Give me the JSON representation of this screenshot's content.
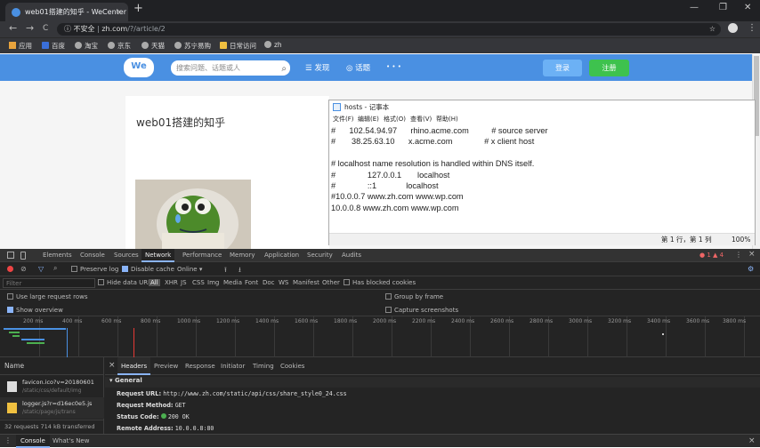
{
  "browser": {
    "tab_title": "web01搭建的知乎 - WeCenter",
    "tab_close": "×",
    "new_tab": "+",
    "window_controls": [
      "—",
      "❐",
      "✕"
    ],
    "nav": [
      "←",
      "→",
      "C"
    ],
    "insecure_label": "不安全",
    "url_host": "zh.com",
    "url_path": "/?/article/2",
    "star": "☆",
    "menu": "⋮",
    "bookmarks": [
      "应用",
      "百度",
      "淘宝",
      "京东",
      "天猫",
      "苏宁易购",
      "日常访问",
      "zh"
    ]
  },
  "site": {
    "logo": "We",
    "search_placeholder": "搜索问题、话题或人",
    "nav_discover": "☰ 发现",
    "nav_topics": "◎ 话题",
    "nav_more": "• • •",
    "login": "登录",
    "register": "注册",
    "article_title": "web01搭建的知乎"
  },
  "notepad": {
    "title": "hosts - 记事本",
    "menu": [
      "文件(F)",
      "编辑(E)",
      "格式(O)",
      "查看(V)",
      "帮助(H)"
    ],
    "content": "#      102.54.94.97      rhino.acme.com          # source server\n#       38.25.63.10      x.acme.com              # x client host\n\n# localhost name resolution is handled within DNS itself.\n#              127.0.0.1       localhost\n#              ::1             localhost\n#10.0.0.7 www.zh.com www.wp.com\n10.0.0.8 www.zh.com www.wp.com",
    "status_position": "第 1 行，第 1 列",
    "status_zoom": "100%"
  },
  "devtools": {
    "tabs": [
      "Elements",
      "Console",
      "Sources",
      "Network",
      "Performance",
      "Memory",
      "Application",
      "Security",
      "Audits"
    ],
    "active_tab": "Network",
    "badges": "● 1  ▲ 4",
    "preserve_log": "Preserve log",
    "disable_cache": "Disable cache",
    "throttle": "Online",
    "filter_placeholder": "Filter",
    "hide_data_urls": "Hide data URLs",
    "filter_types": [
      "All",
      "XHR",
      "JS",
      "CSS",
      "Img",
      "Media",
      "Font",
      "Doc",
      "WS",
      "Manifest",
      "Other"
    ],
    "has_blocked_cookies": "Has blocked cookies",
    "use_large_rows": "Use large request rows",
    "group_by_frame": "Group by frame",
    "show_overview": "Show overview",
    "capture_screenshots": "Capture screenshots",
    "timeline_ticks": [
      "200 ms",
      "400 ms",
      "600 ms",
      "800 ms",
      "1000 ms",
      "1200 ms",
      "1400 ms",
      "1600 ms",
      "1800 ms",
      "2000 ms",
      "2200 ms",
      "2400 ms",
      "2600 ms",
      "2800 ms",
      "3000 ms",
      "3200 ms",
      "3400 ms",
      "3600 ms",
      "3800 ms"
    ],
    "name_header": "Name",
    "requests": [
      {
        "name": "favicon.ico?v=20180601",
        "path": "/static/css/default/img"
      },
      {
        "name": "logger.js?r=d16ec0e5.js",
        "path": "/static/page/js/trans"
      }
    ],
    "summary": "32 requests    714 kB transferred",
    "detail_tabs": [
      "Headers",
      "Preview",
      "Response",
      "Initiator",
      "Timing",
      "Cookies"
    ],
    "general_label": "▾ General",
    "request_url_label": "Request URL:",
    "request_url": "http://www.zh.com/static/api/css/share_style0_24.css",
    "request_method_label": "Request Method:",
    "request_method": "GET",
    "status_code_label": "Status Code:",
    "status_code": "200 OK",
    "remote_address_label": "Remote Address:",
    "remote_address": "10.0.0.8:80",
    "drawer_tabs": [
      "Console",
      "What's New"
    ],
    "close": "×"
  }
}
